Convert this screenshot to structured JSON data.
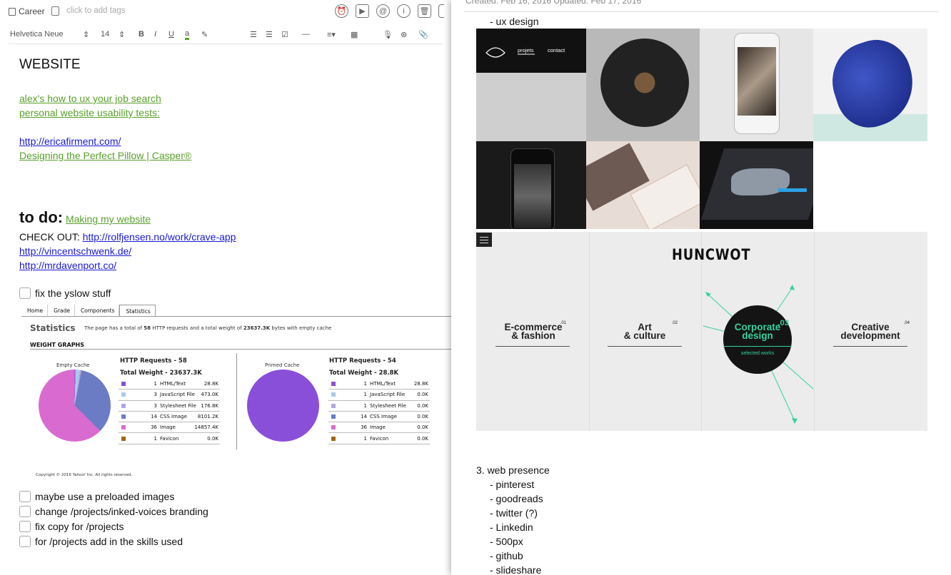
{
  "app": {
    "notebook": "Career",
    "tag_placeholder": "click to add tags"
  },
  "format_bar": {
    "font": "Helvetica Neue",
    "size": "14",
    "bold": "B",
    "italic": "I",
    "underline": "U",
    "text_color": "a"
  },
  "top_icons": [
    "reminder-icon",
    "present-icon",
    "at-icon",
    "info-icon",
    "trash-icon"
  ],
  "note": {
    "title": "WEBSITE",
    "links": [
      "alex's how to ux your job search",
      "personal website usability tests:"
    ],
    "url1": "http://ericafirment.com/",
    "link2": "Designing the Perfect Pillow | Casper®",
    "todo_heading": "to do:",
    "todo_link": "Making my website",
    "check_out_label": "CHECK OUT:",
    "check_out_url": "http://rolfjensen.no/work/crave-app",
    "url_vincent": "http://vincentschwenk.de/",
    "url_mrdavenport": "http://mrdavenport.co/",
    "checkbox_first": "fix the yslow stuff",
    "checkboxes": [
      "maybe use a preloaded images",
      "change /projects/inked-voices branding",
      "fix copy for /projects",
      "for /projects add in the skills used"
    ]
  },
  "yslow": {
    "tabs": [
      "Home",
      "Grade",
      "Components",
      "Statistics"
    ],
    "title": "Statistics",
    "summary_pre": "The page has a total of ",
    "requests": "58",
    "summary_mid": " HTTP requests and a total weight of ",
    "weight": "23637.3K",
    "summary_post": " bytes with empty cache",
    "section": "WEIGHT GRAPHS",
    "empty_cache": {
      "caption": "Empty Cache",
      "requests_label": "HTTP Requests - 58",
      "weight_label": "Total Weight - 23637.3K",
      "rows": [
        {
          "count": "1",
          "type": "HTML/Text",
          "size": "28.8K",
          "color": "#8a4fd8"
        },
        {
          "count": "3",
          "type": "JavaScript File",
          "size": "473.0K",
          "color": "#a9cbe8"
        },
        {
          "count": "3",
          "type": "Stylesheet File",
          "size": "176.8K",
          "color": "#b2a4e3"
        },
        {
          "count": "14",
          "type": "CSS Image",
          "size": "8101.2K",
          "color": "#6b7cc4"
        },
        {
          "count": "36",
          "type": "Image",
          "size": "14857.4K",
          "color": "#d96bd0"
        },
        {
          "count": "1",
          "type": "Favicon",
          "size": "0.0K",
          "color": "#a5650f"
        }
      ]
    },
    "primed_cache": {
      "caption": "Primed Cache",
      "requests_label": "HTTP Requests - 54",
      "weight_label": "Total Weight - 28.8K",
      "rows": [
        {
          "count": "1",
          "type": "HTML/Text",
          "size": "28.8K",
          "color": "#8a4fd8"
        },
        {
          "count": "1",
          "type": "JavaScript File",
          "size": "0.0K",
          "color": "#a9cbe8"
        },
        {
          "count": "1",
          "type": "Stylesheet File",
          "size": "0.0K",
          "color": "#b2a4e3"
        },
        {
          "count": "14",
          "type": "CSS Image",
          "size": "0.0K",
          "color": "#6b7cc4"
        },
        {
          "count": "36",
          "type": "Image",
          "size": "0.0K",
          "color": "#d96bd0"
        },
        {
          "count": "1",
          "type": "Favicon",
          "size": "0.0K",
          "color": "#a5650f"
        }
      ]
    },
    "copyright": "Copyright © 2016 Yahoo! Inc. All rights reserved."
  },
  "right": {
    "meta": "Created: Feb 16, 2016     Updated: Feb 17, 2016",
    "ux": "- ux design",
    "portfolio_nav": [
      "projets",
      "contact"
    ],
    "huncwot": {
      "logo": "HUNCWOT",
      "items": [
        {
          "label": "E-commerce\n& fashion",
          "num": ".01"
        },
        {
          "label": "Art\n& culture",
          "num": ".02"
        },
        {
          "label": "Corporate\ndesign",
          "num": ".03"
        },
        {
          "label": "Creative\ndevelopment",
          "num": ".04"
        }
      ],
      "selected": "selected works"
    },
    "web_heading": "3. web presence",
    "web_items": [
      "- pinterest",
      "- goodreads",
      "- twitter (?)",
      "- Linkedin",
      "- 500px",
      "- github",
      "- slideshare"
    ]
  },
  "colors": {
    "green_link": "#5aa02c",
    "blue_link": "#1a1ad6",
    "accent_green": "#35d39a"
  }
}
